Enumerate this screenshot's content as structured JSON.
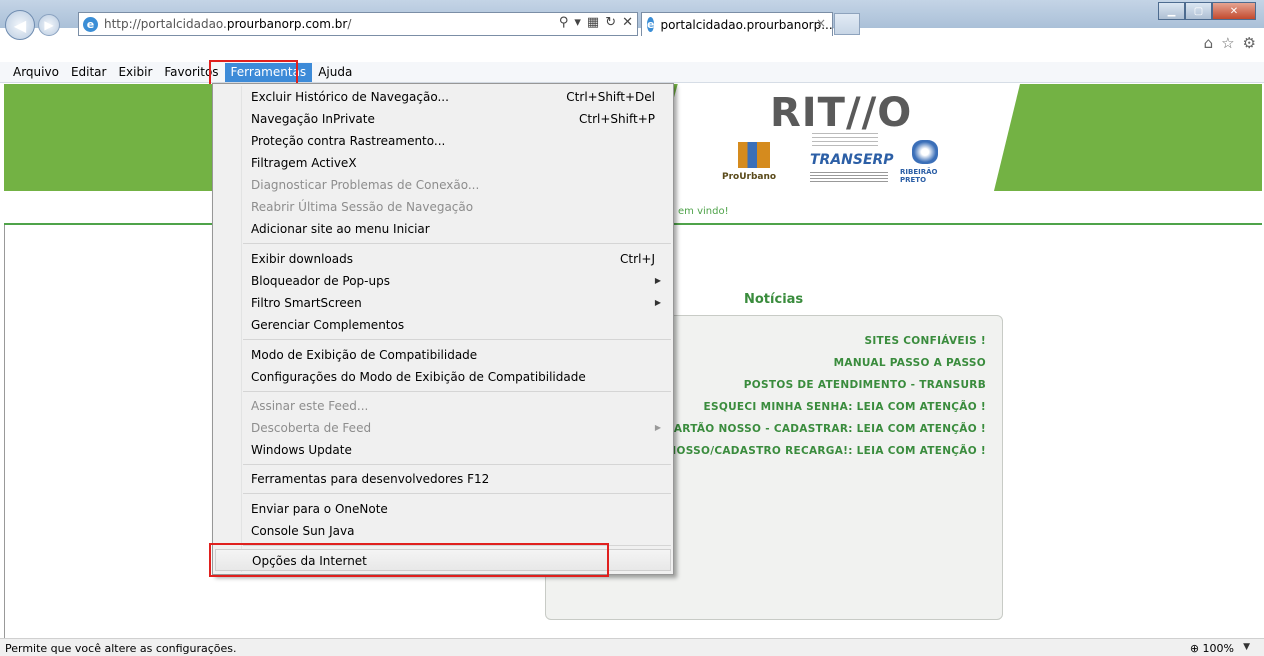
{
  "browser": {
    "url_prefix": "http://portalcidadao.",
    "url_domain": "prourbanorp.com.br",
    "url_suffix": "/",
    "tab_title": "portalcidadao.prourbanorp....",
    "tab_close": "×"
  },
  "menubar": {
    "items": [
      "Arquivo",
      "Editar",
      "Exibir",
      "Favoritos",
      "Ferramentas",
      "Ajuda"
    ],
    "active": "Ferramentas"
  },
  "tools_menu": {
    "items": [
      {
        "label": "Excluir Histórico de Navegação...",
        "shortcut": "Ctrl+Shift+Del"
      },
      {
        "label": "Navegação InPrivate",
        "shortcut": "Ctrl+Shift+P"
      },
      {
        "label": "Proteção contra Rastreamento..."
      },
      {
        "label": "Filtragem ActiveX"
      },
      {
        "label": "Diagnosticar Problemas de Conexão..."
      },
      {
        "label": "Reabrir Última Sessão de Navegação"
      },
      {
        "label": "Adicionar site ao menu Iniciar"
      },
      {
        "label": "Exibir downloads",
        "shortcut": "Ctrl+J"
      },
      {
        "label": "Bloqueador de Pop-ups"
      },
      {
        "label": "Filtro SmartScreen"
      },
      {
        "label": "Gerenciar Complementos"
      },
      {
        "label": "Modo de Exibição de Compatibilidade"
      },
      {
        "label": "Configurações do Modo de Exibição de Compatibilidade"
      },
      {
        "label": "Assinar este Feed..."
      },
      {
        "label": "Descoberta de Feed"
      },
      {
        "label": "Windows Update"
      },
      {
        "label": "Ferramentas para desenvolvedores F12"
      },
      {
        "label": "Enviar para o OneNote"
      },
      {
        "label": "Console Sun Java"
      },
      {
        "label": "Opções da Internet"
      }
    ]
  },
  "page": {
    "logo": "RIT//O",
    "logo_prourbano": "ProUrbano",
    "logo_transerp": "TRANSERP",
    "logo_rp": "RIBEIRÃO PRETO",
    "welcome_fragment": "em vindo!",
    "news_title": "Notícias",
    "news_items": [
      "SITES CONFIÁVEIS !",
      "MANUAL PASSO A PASSO",
      "POSTOS DE ATENDIMENTO - TRANSURB",
      "ESQUECI MINHA SENHA: LEIA COM ATENÇÃO !",
      "O CARTÃO NOSSO - CADASTRAR: LEIA COM ATENÇÃO !",
      "O NOSSO/CADASTRO RECARGA!: LEIA COM ATENÇÃO !"
    ]
  },
  "statusbar": {
    "text": "Permite que você altere as configurações.",
    "zoom": "100%"
  },
  "colors": {
    "banner_green": "#73b244",
    "news_green": "#3a8c3d",
    "menu_highlight": "#3d8bd8",
    "annotation_red": "#e0201e"
  }
}
